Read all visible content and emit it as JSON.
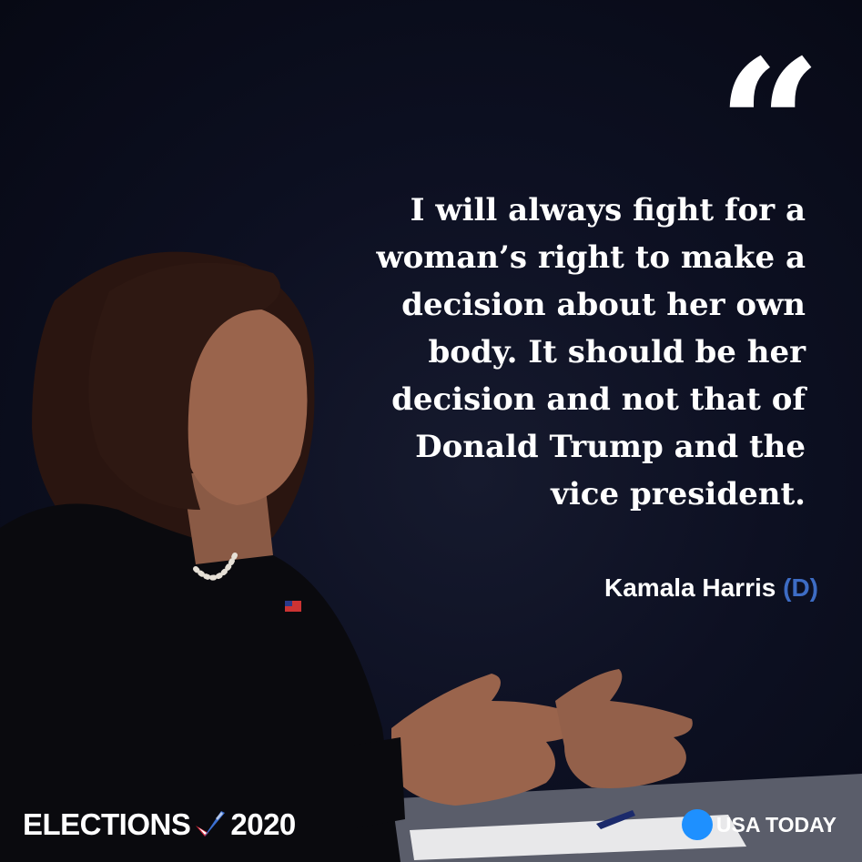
{
  "quote": {
    "mark": "“",
    "lines": [
      "I will always fight for a",
      "woman’s right to make a",
      "decision about her own",
      "body. It should be her",
      "decision and not that of",
      "Donald Trump and the",
      "vice president."
    ]
  },
  "attribution": {
    "name": "Kamala Harris",
    "party": "(D)"
  },
  "footer": {
    "left_pre": "ELECTIONS",
    "left_year": "2020",
    "right_brand": "USA TODAY"
  },
  "colors": {
    "background": "#0d1022",
    "text": "#ffffff",
    "party": "#3d6cc4",
    "usa_today_dot": "#1e90ff"
  },
  "icons": [
    "checkmark-flag-icon",
    "usa-today-dot-icon"
  ]
}
